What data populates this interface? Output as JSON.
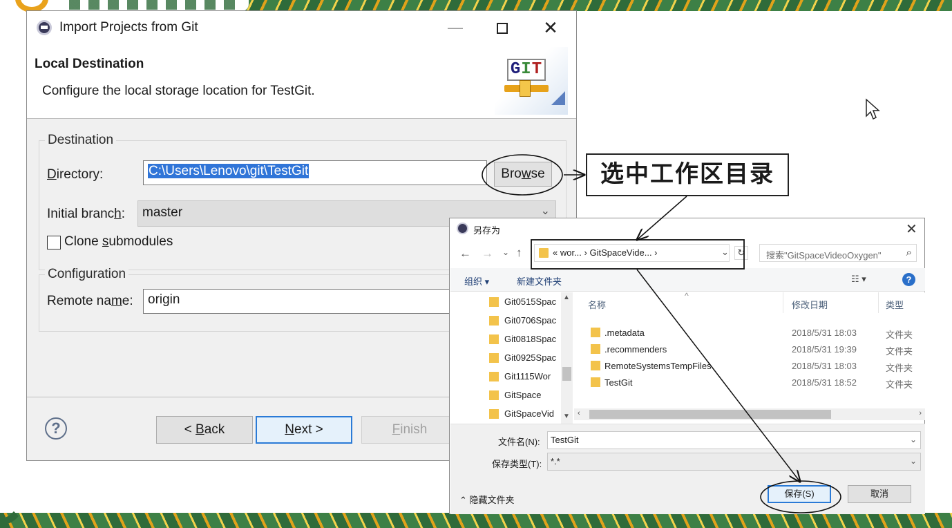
{
  "eclipse_dialog": {
    "window_title": "Import Projects from Git",
    "header_title": "Local Destination",
    "header_desc": "Configure the local storage location for TestGit.",
    "destination_group": "Destination",
    "directory_label": "Directory:",
    "directory_value": "C:\\Users\\Lenovo\\git\\TestGit",
    "browse_label": "Browse",
    "initial_branch_label": "Initial branch:",
    "initial_branch_value": "master",
    "clone_submodules_label": "Clone submodules",
    "configuration_group": "Configuration",
    "remote_name_label": "Remote name:",
    "remote_name_value": "origin",
    "back_label": "< Back",
    "next_label": "Next >",
    "finish_label": "Finish"
  },
  "save_dialog": {
    "title": "另存为",
    "breadcrumb": "« wor... › GitSpaceVide... ›",
    "search_placeholder": "搜索\"GitSpaceVideoOxygen\"",
    "organize_label": "组织 ▾",
    "new_folder_label": "新建文件夹",
    "nav_items": [
      "Git0515Spac",
      "Git0706Spac",
      "Git0818Spac",
      "Git0925Spac",
      "Git1115Wor",
      "GitSpace",
      "GitSpaceVid"
    ],
    "columns": {
      "name": "名称",
      "date": "修改日期",
      "type": "类型"
    },
    "rows": [
      {
        "name": ".metadata",
        "date": "2018/5/31 18:03",
        "type": "文件夹"
      },
      {
        "name": ".recommenders",
        "date": "2018/5/31 19:39",
        "type": "文件夹"
      },
      {
        "name": "RemoteSystemsTempFiles",
        "date": "2018/5/31 18:03",
        "type": "文件夹"
      },
      {
        "name": "TestGit",
        "date": "2018/5/31 18:52",
        "type": "文件夹"
      }
    ],
    "filename_label": "文件名(N):",
    "filename_value": "TestGit",
    "filetype_label": "保存类型(T):",
    "filetype_value": "*.*",
    "hide_folders_label": "隐藏文件夹",
    "save_label": "保存(S)",
    "cancel_label": "取消"
  },
  "annotation": {
    "callout_text": "选中工作区目录"
  }
}
